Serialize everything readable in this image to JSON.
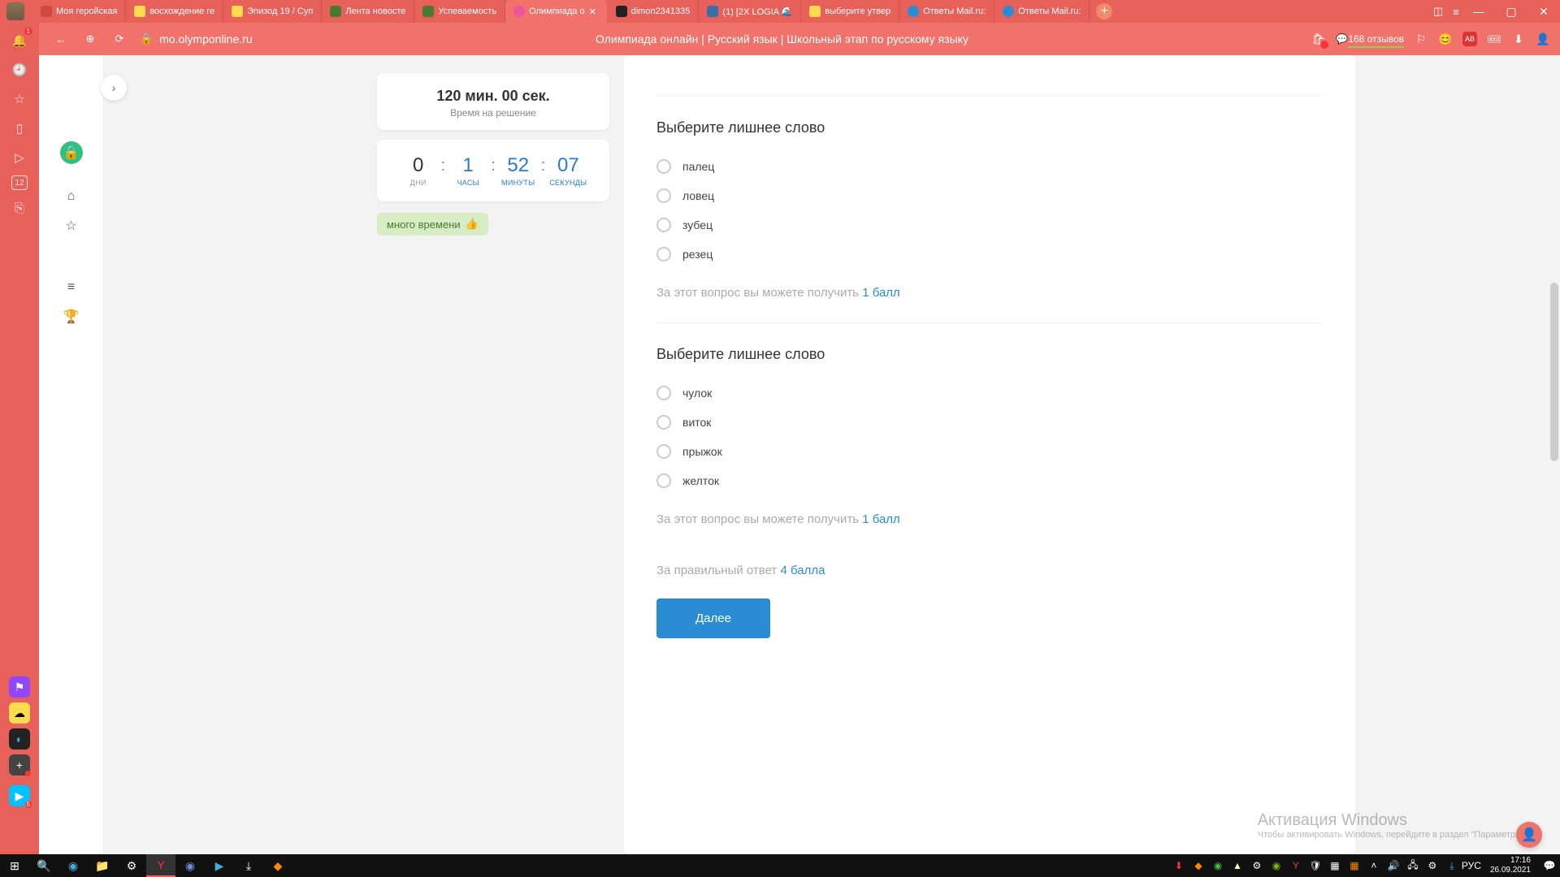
{
  "browser": {
    "tabs": [
      {
        "label": "Моя геройская",
        "icon_color": "#d04a3f"
      },
      {
        "label": "восхождение ге",
        "icon_color": "#ffdb4d"
      },
      {
        "label": "Эпизод 19 / Суп",
        "icon_color": "#ffdb4d"
      },
      {
        "label": "Лента новосте",
        "icon_color": "#4a7a2e"
      },
      {
        "label": "Успеваемость",
        "icon_color": "#4a7a2e"
      },
      {
        "label": "Олимпиада о",
        "icon_color": "#ee5599",
        "active": true
      },
      {
        "label": "dimon2341335",
        "icon_color": "#222"
      },
      {
        "label": "(1) [2X LOGIA 🌊",
        "icon_color": "#3a6ea5"
      },
      {
        "label": "выберите утвер",
        "icon_color": "#ffdb4d"
      },
      {
        "label": "Ответы Mail.ru:",
        "icon_color": "#2a8dd4"
      },
      {
        "label": "Ответы Mail.ru:",
        "icon_color": "#2a8dd4"
      }
    ],
    "url": "mo.olymponline.ru",
    "page_title": "Олимпиада онлайн | Русский язык | Школьный этап по русскому языку",
    "reviews": "168 отзывов",
    "notif_count": "1"
  },
  "timer": {
    "total": "120 мин. 00 сек.",
    "sub": "Время на решение",
    "days": "0",
    "days_lbl": "ДНИ",
    "hours": "1",
    "hours_lbl": "ЧАСЫ",
    "minutes": "52",
    "minutes_lbl": "МИНУТЫ",
    "seconds": "07",
    "seconds_lbl": "СЕКУНДЫ",
    "pill": "много времени",
    "pill_emoji": "👍"
  },
  "q1": {
    "title": "Выберите лишнее слово",
    "options": [
      "палец",
      "ловец",
      "зубец",
      "резец"
    ],
    "points_text": "За этот вопрос вы можете получить ",
    "points_val": "1 балл"
  },
  "q2": {
    "title": "Выберите лишнее слово",
    "options": [
      "чулок",
      "виток",
      "прыжок",
      "желток"
    ],
    "points_text": "За этот вопрос вы можете получить ",
    "points_val": "1 балл"
  },
  "total": {
    "text": "За правильный ответ ",
    "val": "4 балла",
    "next": "Далее"
  },
  "watermark": {
    "title": "Активация Windows",
    "sub": "Чтобы активировать Windows, перейдите в раздел \"Параметры\"."
  },
  "taskbar": {
    "time": "17:16",
    "date": "26.09.2021",
    "lang": "РУС"
  }
}
